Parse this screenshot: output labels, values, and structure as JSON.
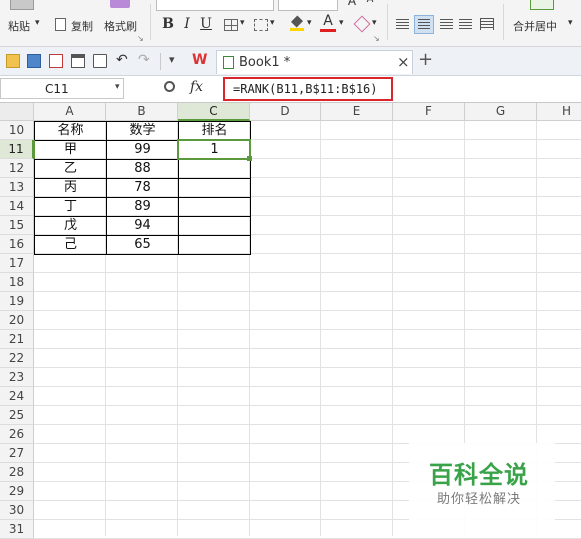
{
  "ribbon": {
    "paste_label": "粘贴",
    "copy_label": "复制",
    "format_painter_label": "格式刷",
    "bold": "B",
    "italic": "I",
    "underline": "U",
    "font_color_glyph": "A",
    "merge_center_label": "合并居中"
  },
  "toolbar": {
    "wps_logo": "W",
    "doc_tab_title": "Book1 *",
    "close_glyph": "×",
    "new_tab_glyph": "+"
  },
  "formula_bar": {
    "name_box": "C11",
    "fx_label": "fx",
    "formula": "=RANK(B11,B$11:B$16)"
  },
  "sheet": {
    "columns": [
      "A",
      "B",
      "C",
      "D",
      "E",
      "F",
      "G",
      "H"
    ],
    "rows": [
      "10",
      "11",
      "12",
      "13",
      "14",
      "15",
      "16",
      "17",
      "18",
      "19",
      "20",
      "21",
      "22",
      "23",
      "24",
      "25",
      "26",
      "27",
      "28",
      "29",
      "30",
      "31"
    ],
    "header_row": {
      "name": "名称",
      "score": "数学",
      "rank": "排名"
    },
    "records": [
      {
        "name": "甲",
        "score": "99",
        "rank": "1"
      },
      {
        "name": "乙",
        "score": "88",
        "rank": ""
      },
      {
        "name": "丙",
        "score": "78",
        "rank": ""
      },
      {
        "name": "丁",
        "score": "89",
        "rank": ""
      },
      {
        "name": "戊",
        "score": "94",
        "rank": ""
      },
      {
        "name": "己",
        "score": "65",
        "rank": ""
      }
    ],
    "selected_column": "C",
    "selected_row": "11"
  },
  "watermark": {
    "title": "百科全说",
    "subtitle": "助你轻松解决"
  },
  "colors": {
    "accent_green": "#5b9a3c",
    "formula_highlight": "#d9262c",
    "watermark_green": "#3aa34a"
  }
}
